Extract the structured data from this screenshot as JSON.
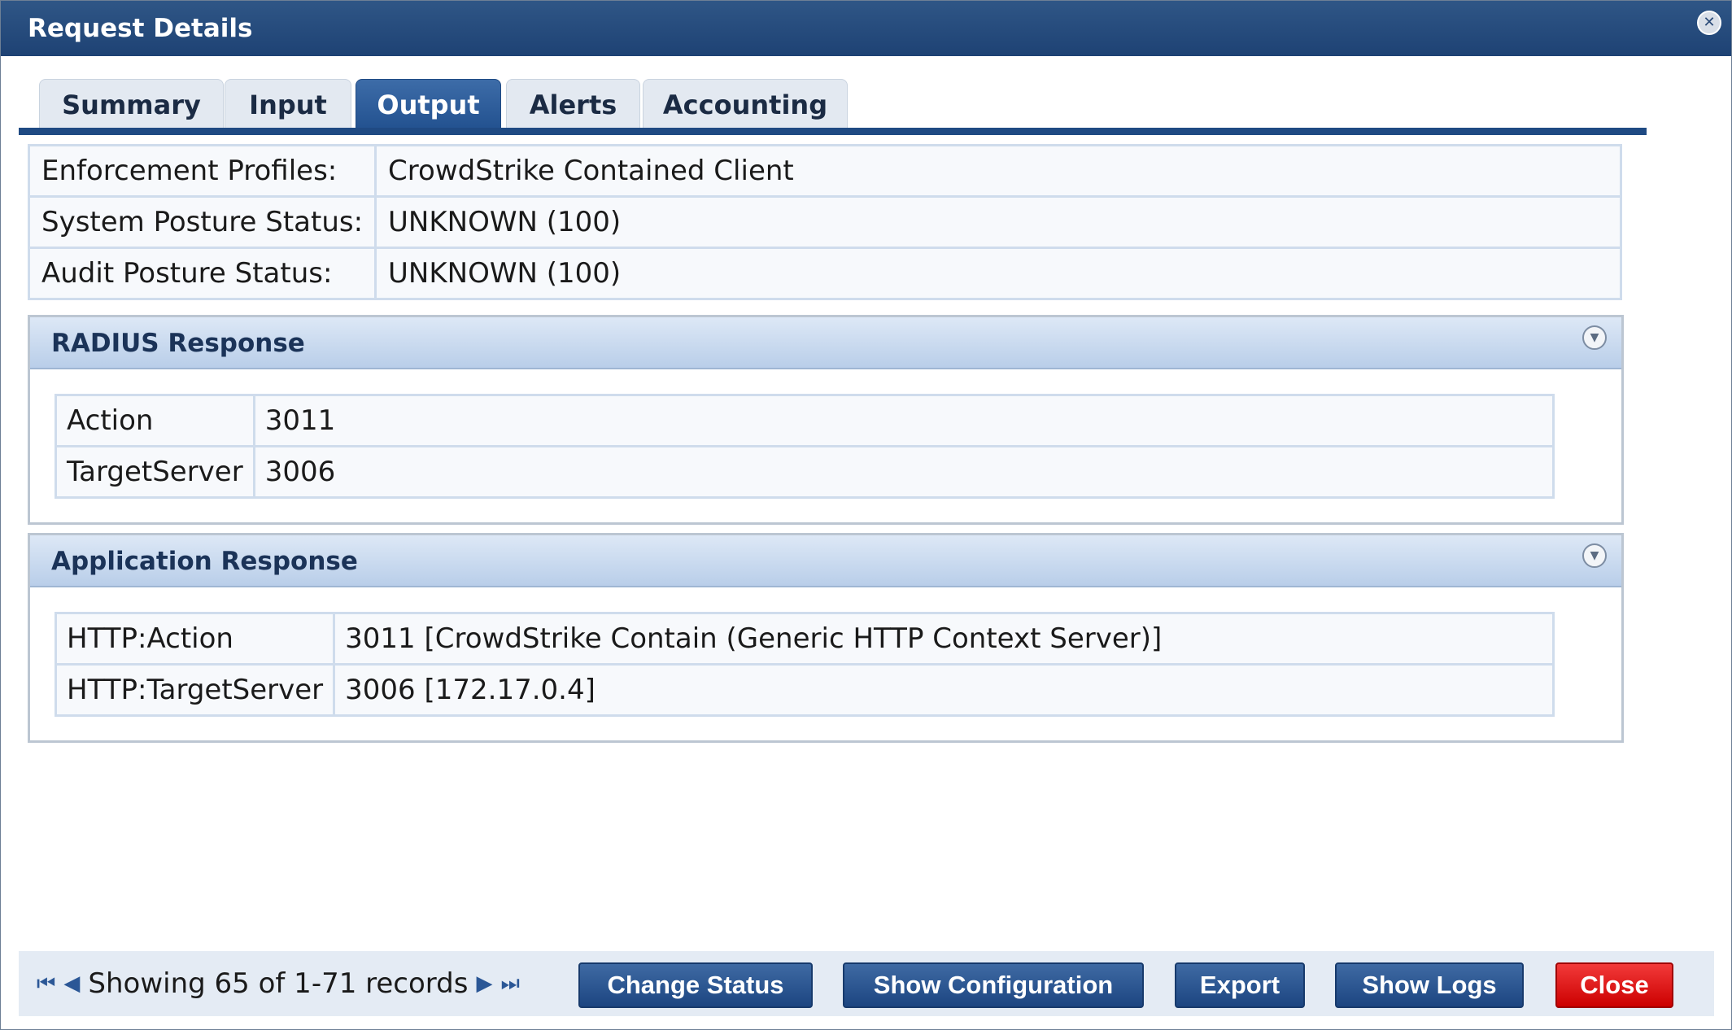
{
  "window": {
    "title": "Request Details"
  },
  "tabs": [
    {
      "label": "Summary"
    },
    {
      "label": "Input"
    },
    {
      "label": "Output"
    },
    {
      "label": "Alerts"
    },
    {
      "label": "Accounting"
    }
  ],
  "active_tab": "Output",
  "output": {
    "enforcement_profiles_label": "Enforcement Profiles:",
    "enforcement_profiles_value": "CrowdStrike Contained Client",
    "system_posture_label": "System Posture Status:",
    "system_posture_value": "UNKNOWN (100)",
    "audit_posture_label": "Audit Posture Status:",
    "audit_posture_value": "UNKNOWN (100)"
  },
  "radius": {
    "title": "RADIUS Response",
    "rows": [
      {
        "key": "Action",
        "value": "3011"
      },
      {
        "key": "TargetServer",
        "value": "3006"
      }
    ]
  },
  "application": {
    "title": "Application Response",
    "rows": [
      {
        "key": "HTTP:Action",
        "value": "3011 [CrowdStrike Contain (Generic HTTP Context Server)]"
      },
      {
        "key": "HTTP:TargetServer",
        "value": "3006 [172.17.0.4]"
      }
    ]
  },
  "footer": {
    "pager_text": "Showing 65 of 1-71 records",
    "buttons": {
      "change_status": "Change Status",
      "show_configuration": "Show Configuration",
      "export": "Export",
      "show_logs": "Show Logs",
      "close": "Close"
    }
  },
  "colors": {
    "title_bar": "#1e4274",
    "tab_active": "#22518f",
    "button": "#1c4581",
    "close_button": "#cc0000"
  },
  "icons": {
    "window_close": "close-circle-icon",
    "panel_toggle": "collapse-chevron-icon",
    "pager": [
      "first-page-icon",
      "prev-page-icon",
      "next-page-icon",
      "last-page-icon"
    ]
  }
}
